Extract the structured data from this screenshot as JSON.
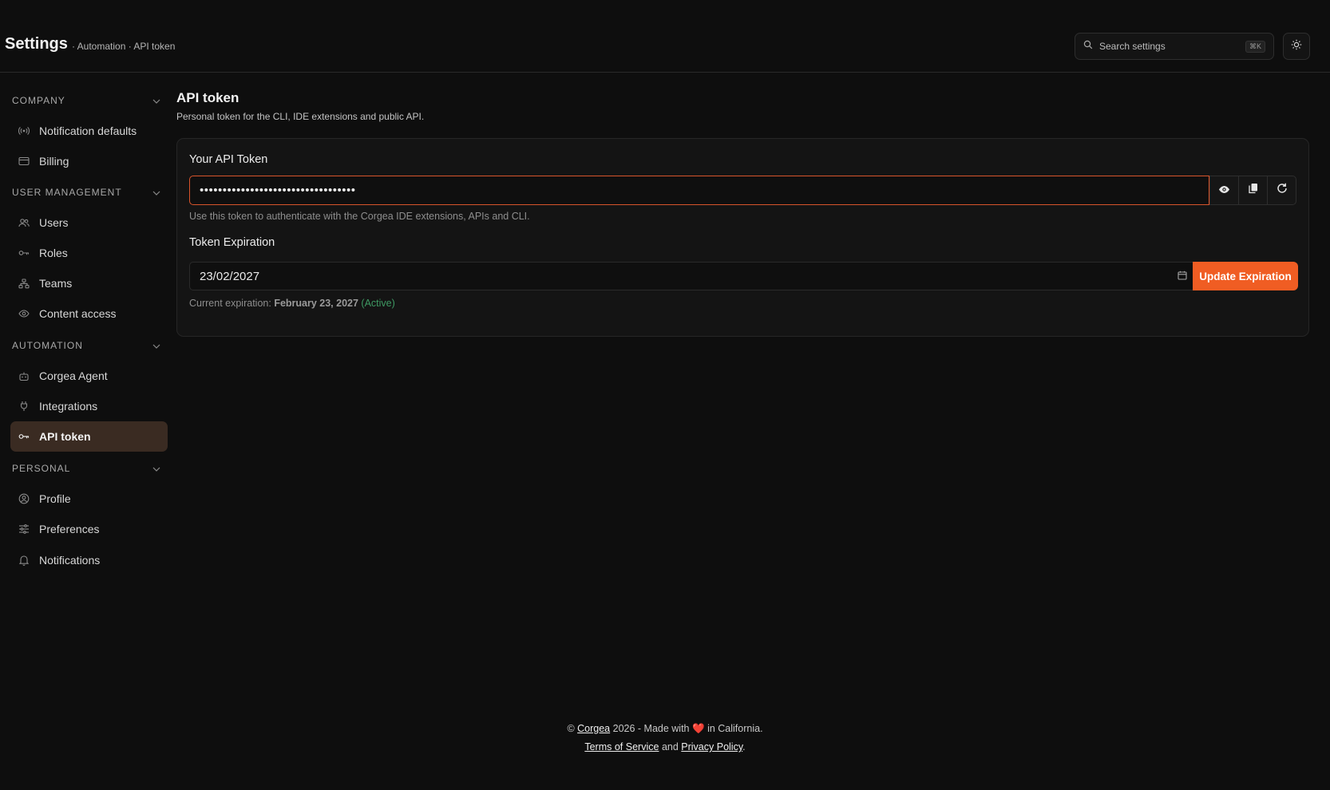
{
  "header": {
    "title": "Settings",
    "breadcrumb": "· Automation · API token",
    "search": {
      "placeholder": "Search settings",
      "shortcut": "⌘K"
    }
  },
  "sidebar": {
    "sections": [
      {
        "label": "COMPANY",
        "items": [
          "Notification defaults",
          "Billing"
        ]
      },
      {
        "label": "USER MANAGEMENT",
        "items": [
          "Users",
          "Roles",
          "Teams",
          "Content access"
        ]
      },
      {
        "label": "AUTOMATION",
        "items": [
          "Corgea Agent",
          "Integrations",
          "API token"
        ]
      },
      {
        "label": "PERSONAL",
        "items": [
          "Profile",
          "Preferences",
          "Notifications"
        ]
      }
    ],
    "active_item": "API token"
  },
  "main": {
    "title": "API token",
    "subtitle": "Personal token for the CLI, IDE extensions and public API.",
    "token": {
      "label": "Your API Token",
      "value": "••••••••••••••••••••••••••••••••••",
      "help": "Use this token to authenticate with the Corgea IDE extensions, APIs and CLI."
    },
    "expiration": {
      "label": "Token Expiration",
      "value": "23/02/2027",
      "button": "Update Expiration",
      "current_prefix": "Current expiration:",
      "current_date": "February 23, 2027",
      "status": "(Active)"
    }
  },
  "footer": {
    "copyright": "©",
    "brand": "Corgea",
    "year_text": "2026 - Made with",
    "heart": "❤️",
    "location": "in California.",
    "terms": "Terms of Service",
    "and": "and",
    "privacy": "Privacy Policy",
    "period": "."
  },
  "colors": {
    "accent": "#f05d23",
    "active_nav": "#3a2b22",
    "status_active": "#3e9a63"
  }
}
